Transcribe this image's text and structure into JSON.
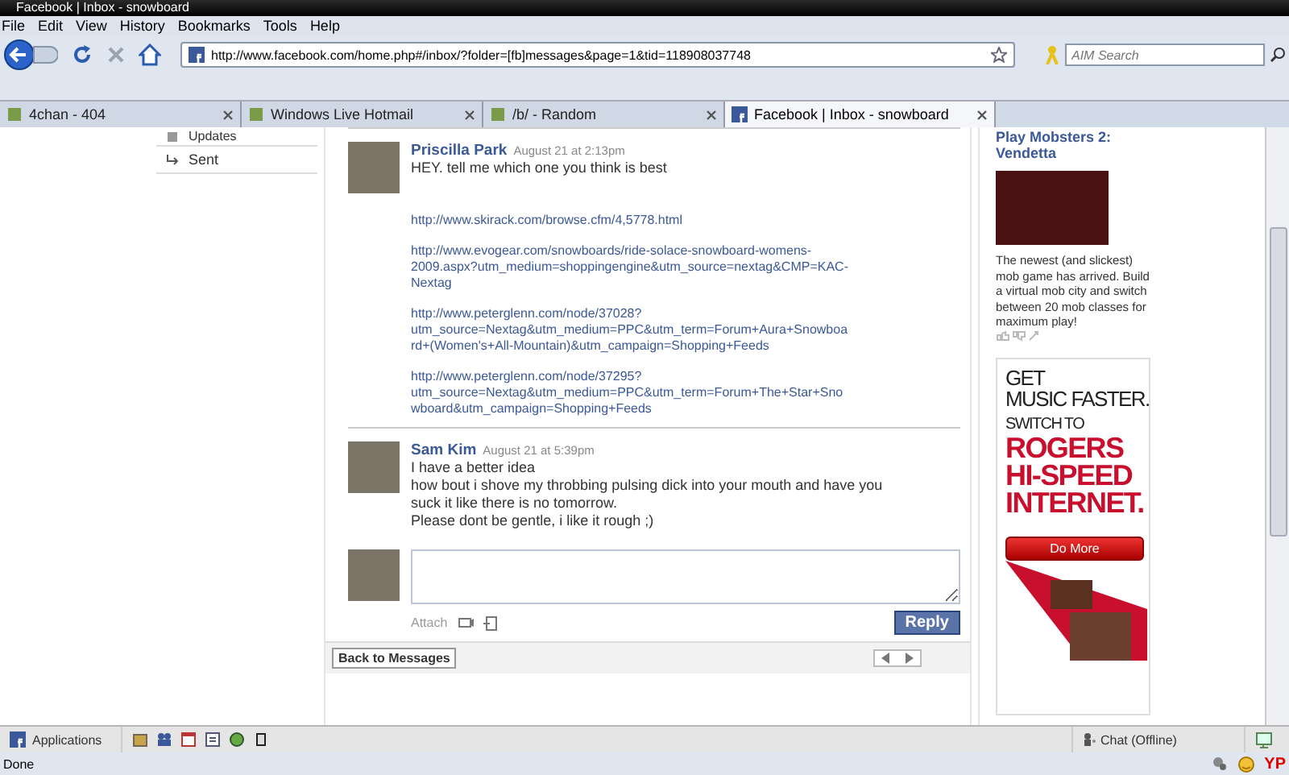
{
  "window": {
    "title": "Facebook | Inbox - snowboard"
  },
  "menu": [
    "File",
    "Edit",
    "View",
    "History",
    "Bookmarks",
    "Tools",
    "Help"
  ],
  "address": {
    "url": "http://www.facebook.com/home.php#/inbox/?folder=[fb]messages&page=1&tid=118908037748"
  },
  "search": {
    "placeholder": "AIM Search"
  },
  "tabs": [
    {
      "label": "4chan - 404",
      "selected": false
    },
    {
      "label": "Windows Live Hotmail",
      "selected": false
    },
    {
      "label": "/b/ - Random",
      "selected": false
    },
    {
      "label": "Facebook | Inbox - snowboard",
      "selected": true
    }
  ],
  "sidebar": {
    "items": [
      {
        "label": "Updates"
      },
      {
        "label": "Sent"
      }
    ]
  },
  "messages": [
    {
      "author": "Priscilla Park",
      "time": "August 21 at 2:13pm",
      "lines": [
        "HEY. tell me which one you think is best"
      ],
      "links": [
        "http://www.skirack.com/browse.cfm/4,5778.html",
        "http://www.evogear.com/snowboards/ride-solace-snowboard-womens-2009.aspx?utm_medium=shoppingengine&utm_source=nextag&CMP=KAC-Nextag",
        "http://www.peterglenn.com/node/37028?utm_source=Nextag&utm_medium=PPC&utm_term=Forum+Aura+Snowboard+(Women's+All-Mountain)&utm_campaign=Shopping+Feeds",
        "http://www.peterglenn.com/node/37295?utm_source=Nextag&utm_medium=PPC&utm_term=Forum+The+Star+Snowboard&utm_campaign=Shopping+Feeds"
      ]
    },
    {
      "author": "Sam Kim",
      "time": "August 21 at 5:39pm",
      "lines": [
        "I have a better idea",
        "how bout i shove my throbbing pulsing dick into your mouth and have you suck it like there is no tomorrow.",
        "Please dont be gentle, i like it rough ;)"
      ]
    }
  ],
  "reply": {
    "attach_label": "Attach",
    "button": "Reply"
  },
  "footer": {
    "back_button": "Back to Messages"
  },
  "ad": {
    "title": "Play Mobsters 2: Vendetta",
    "text": "The newest (and slickest) mob game has arrived. Build a virtual mob city and switch between 20 mob classes for maximum play!",
    "banner": [
      "GET",
      "MUSIC FASTER.",
      "SWITCH TO",
      "ROGERS",
      "HI-SPEED",
      "INTERNET."
    ],
    "button": "Do More"
  },
  "bottom_bar": {
    "applications": "Applications",
    "chat": "Chat (Offline)"
  },
  "status_bar": {
    "text": "Done",
    "badge": "YP"
  }
}
